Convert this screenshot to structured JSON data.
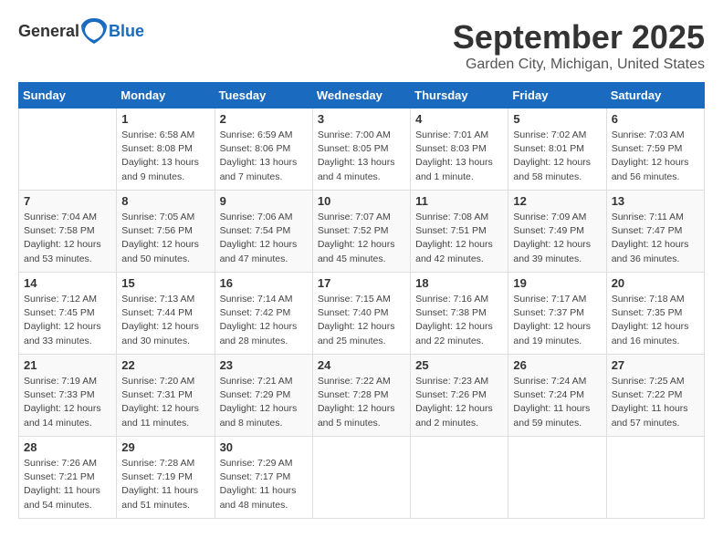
{
  "header": {
    "logo": {
      "general": "General",
      "blue": "Blue"
    },
    "title": "September 2025",
    "subtitle": "Garden City, Michigan, United States"
  },
  "weekdays": [
    "Sunday",
    "Monday",
    "Tuesday",
    "Wednesday",
    "Thursday",
    "Friday",
    "Saturday"
  ],
  "weeks": [
    [
      {
        "day": "",
        "info": ""
      },
      {
        "day": "1",
        "info": "Sunrise: 6:58 AM\nSunset: 8:08 PM\nDaylight: 13 hours\nand 9 minutes."
      },
      {
        "day": "2",
        "info": "Sunrise: 6:59 AM\nSunset: 8:06 PM\nDaylight: 13 hours\nand 7 minutes."
      },
      {
        "day": "3",
        "info": "Sunrise: 7:00 AM\nSunset: 8:05 PM\nDaylight: 13 hours\nand 4 minutes."
      },
      {
        "day": "4",
        "info": "Sunrise: 7:01 AM\nSunset: 8:03 PM\nDaylight: 13 hours\nand 1 minute."
      },
      {
        "day": "5",
        "info": "Sunrise: 7:02 AM\nSunset: 8:01 PM\nDaylight: 12 hours\nand 58 minutes."
      },
      {
        "day": "6",
        "info": "Sunrise: 7:03 AM\nSunset: 7:59 PM\nDaylight: 12 hours\nand 56 minutes."
      }
    ],
    [
      {
        "day": "7",
        "info": "Sunrise: 7:04 AM\nSunset: 7:58 PM\nDaylight: 12 hours\nand 53 minutes."
      },
      {
        "day": "8",
        "info": "Sunrise: 7:05 AM\nSunset: 7:56 PM\nDaylight: 12 hours\nand 50 minutes."
      },
      {
        "day": "9",
        "info": "Sunrise: 7:06 AM\nSunset: 7:54 PM\nDaylight: 12 hours\nand 47 minutes."
      },
      {
        "day": "10",
        "info": "Sunrise: 7:07 AM\nSunset: 7:52 PM\nDaylight: 12 hours\nand 45 minutes."
      },
      {
        "day": "11",
        "info": "Sunrise: 7:08 AM\nSunset: 7:51 PM\nDaylight: 12 hours\nand 42 minutes."
      },
      {
        "day": "12",
        "info": "Sunrise: 7:09 AM\nSunset: 7:49 PM\nDaylight: 12 hours\nand 39 minutes."
      },
      {
        "day": "13",
        "info": "Sunrise: 7:11 AM\nSunset: 7:47 PM\nDaylight: 12 hours\nand 36 minutes."
      }
    ],
    [
      {
        "day": "14",
        "info": "Sunrise: 7:12 AM\nSunset: 7:45 PM\nDaylight: 12 hours\nand 33 minutes."
      },
      {
        "day": "15",
        "info": "Sunrise: 7:13 AM\nSunset: 7:44 PM\nDaylight: 12 hours\nand 30 minutes."
      },
      {
        "day": "16",
        "info": "Sunrise: 7:14 AM\nSunset: 7:42 PM\nDaylight: 12 hours\nand 28 minutes."
      },
      {
        "day": "17",
        "info": "Sunrise: 7:15 AM\nSunset: 7:40 PM\nDaylight: 12 hours\nand 25 minutes."
      },
      {
        "day": "18",
        "info": "Sunrise: 7:16 AM\nSunset: 7:38 PM\nDaylight: 12 hours\nand 22 minutes."
      },
      {
        "day": "19",
        "info": "Sunrise: 7:17 AM\nSunset: 7:37 PM\nDaylight: 12 hours\nand 19 minutes."
      },
      {
        "day": "20",
        "info": "Sunrise: 7:18 AM\nSunset: 7:35 PM\nDaylight: 12 hours\nand 16 minutes."
      }
    ],
    [
      {
        "day": "21",
        "info": "Sunrise: 7:19 AM\nSunset: 7:33 PM\nDaylight: 12 hours\nand 14 minutes."
      },
      {
        "day": "22",
        "info": "Sunrise: 7:20 AM\nSunset: 7:31 PM\nDaylight: 12 hours\nand 11 minutes."
      },
      {
        "day": "23",
        "info": "Sunrise: 7:21 AM\nSunset: 7:29 PM\nDaylight: 12 hours\nand 8 minutes."
      },
      {
        "day": "24",
        "info": "Sunrise: 7:22 AM\nSunset: 7:28 PM\nDaylight: 12 hours\nand 5 minutes."
      },
      {
        "day": "25",
        "info": "Sunrise: 7:23 AM\nSunset: 7:26 PM\nDaylight: 12 hours\nand 2 minutes."
      },
      {
        "day": "26",
        "info": "Sunrise: 7:24 AM\nSunset: 7:24 PM\nDaylight: 11 hours\nand 59 minutes."
      },
      {
        "day": "27",
        "info": "Sunrise: 7:25 AM\nSunset: 7:22 PM\nDaylight: 11 hours\nand 57 minutes."
      }
    ],
    [
      {
        "day": "28",
        "info": "Sunrise: 7:26 AM\nSunset: 7:21 PM\nDaylight: 11 hours\nand 54 minutes."
      },
      {
        "day": "29",
        "info": "Sunrise: 7:28 AM\nSunset: 7:19 PM\nDaylight: 11 hours\nand 51 minutes."
      },
      {
        "day": "30",
        "info": "Sunrise: 7:29 AM\nSunset: 7:17 PM\nDaylight: 11 hours\nand 48 minutes."
      },
      {
        "day": "",
        "info": ""
      },
      {
        "day": "",
        "info": ""
      },
      {
        "day": "",
        "info": ""
      },
      {
        "day": "",
        "info": ""
      }
    ]
  ]
}
